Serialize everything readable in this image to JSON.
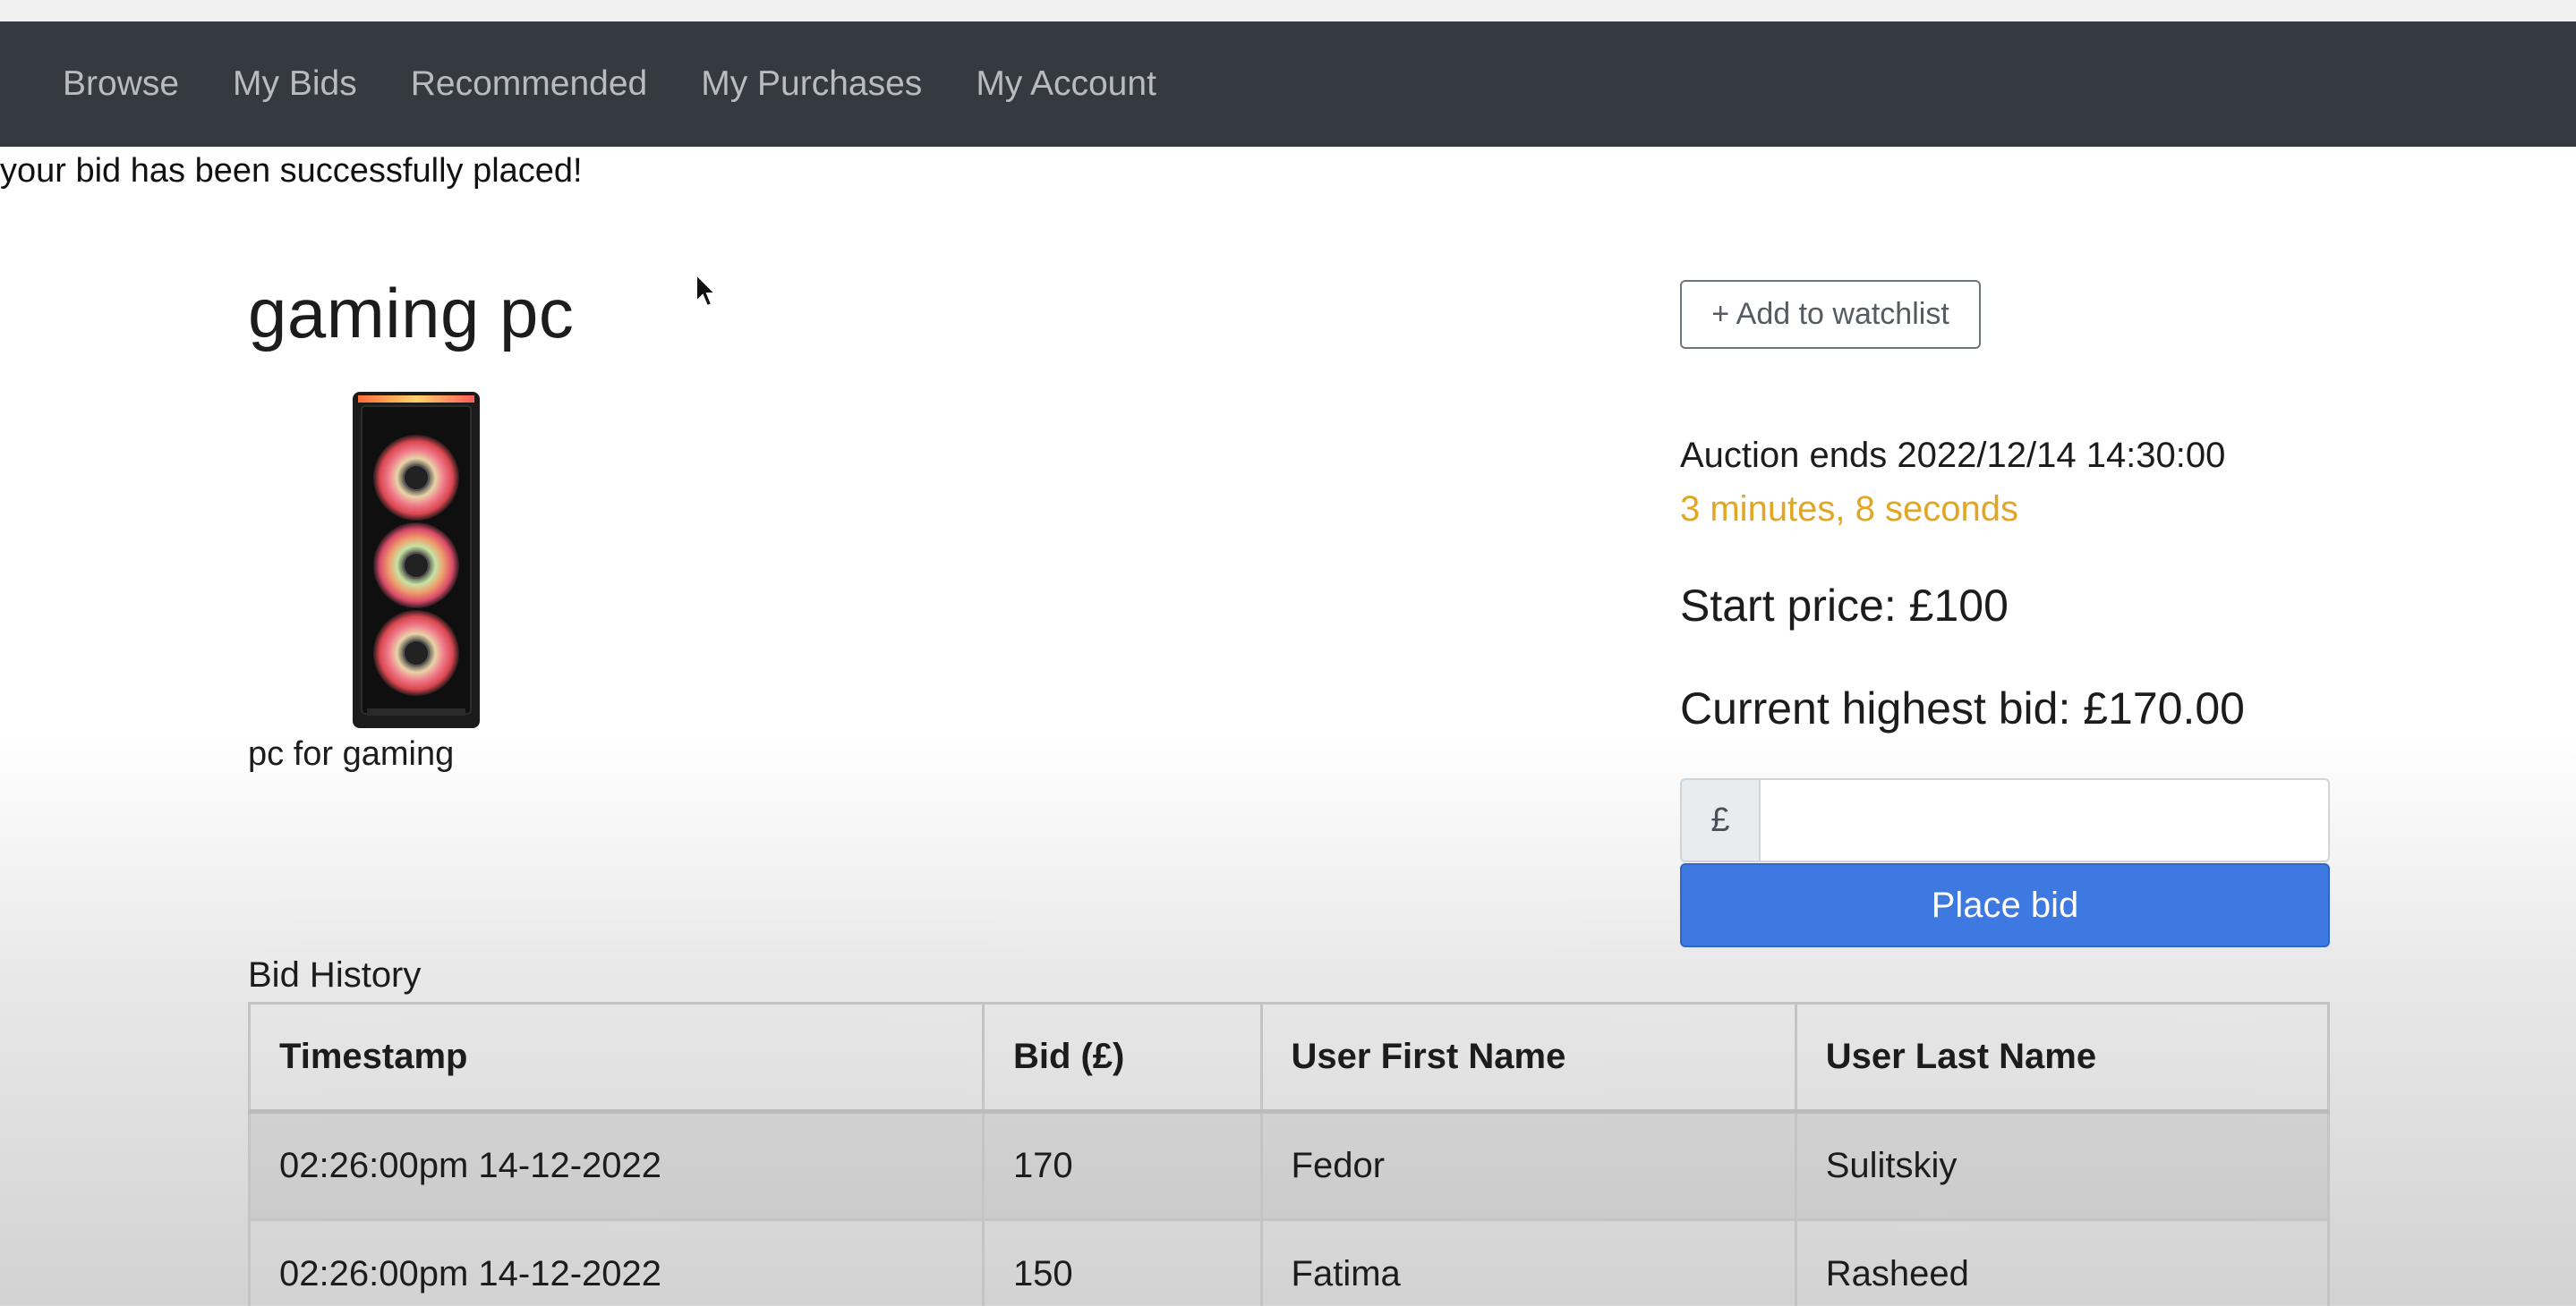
{
  "nav": {
    "items": [
      "Browse",
      "My Bids",
      "Recommended",
      "My Purchases",
      "My Account"
    ]
  },
  "flash_message": "your bid has been successfully placed!",
  "listing": {
    "title": "gaming pc",
    "description": "pc for gaming",
    "watchlist_label": "+ Add to watchlist",
    "auction_ends": "Auction ends 2022/12/14 14:30:00",
    "countdown": "3 minutes, 8 seconds",
    "start_price": "Start price: £100",
    "current_highest": "Current highest bid: £170.00"
  },
  "bid_form": {
    "currency_symbol": "£",
    "value": "",
    "button_label": "Place bid"
  },
  "bid_history": {
    "title": "Bid History",
    "columns": [
      "Timestamp",
      "Bid (£)",
      "User First Name",
      "User Last Name"
    ],
    "rows": [
      [
        "02:26:00pm 14-12-2022",
        "170",
        "Fedor",
        "Sulitskiy"
      ],
      [
        "02:26:00pm 14-12-2022",
        "150",
        "Fatima",
        "Rasheed"
      ]
    ]
  },
  "colors": {
    "navbar": "#343a40",
    "countdown": "#e1a623",
    "primary_button": "#3e78e1"
  },
  "icons": {
    "cursor": "mouse-pointer-icon",
    "product_image": "gaming-pc-case-image"
  }
}
